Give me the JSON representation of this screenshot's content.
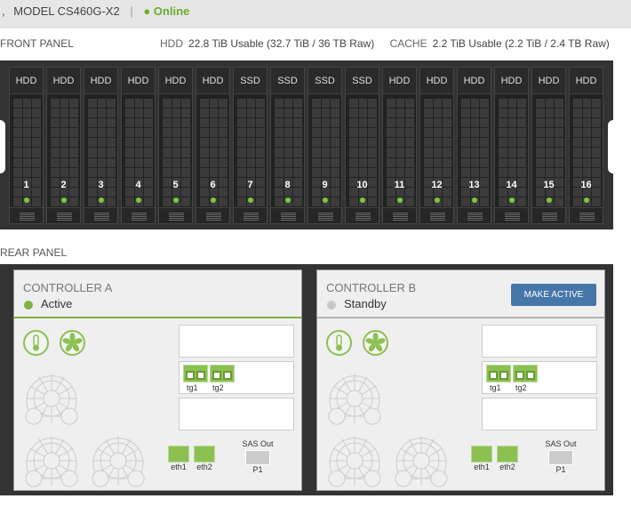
{
  "header": {
    "prefix": ",",
    "model": "MODEL CS460G-X2",
    "separator": "|",
    "status": "● Online"
  },
  "front": {
    "label": "FRONT PANEL",
    "hdd_key": "HDD",
    "hdd_value": "22.8 TiB Usable (32.7 TiB / 36 TB Raw)",
    "cache_key": "CACHE",
    "cache_value": "2.2 TiB Usable (2.2 TiB / 2.4 TB Raw)",
    "drives": [
      {
        "type": "HDD",
        "num": "1"
      },
      {
        "type": "HDD",
        "num": "2"
      },
      {
        "type": "HDD",
        "num": "3"
      },
      {
        "type": "HDD",
        "num": "4"
      },
      {
        "type": "HDD",
        "num": "5"
      },
      {
        "type": "HDD",
        "num": "6"
      },
      {
        "type": "SSD",
        "num": "7"
      },
      {
        "type": "SSD",
        "num": "8"
      },
      {
        "type": "SSD",
        "num": "9"
      },
      {
        "type": "SSD",
        "num": "10"
      },
      {
        "type": "HDD",
        "num": "11"
      },
      {
        "type": "HDD",
        "num": "12"
      },
      {
        "type": "HDD",
        "num": "13"
      },
      {
        "type": "HDD",
        "num": "14"
      },
      {
        "type": "HDD",
        "num": "15"
      },
      {
        "type": "HDD",
        "num": "16"
      }
    ]
  },
  "rear": {
    "label": "REAR PANEL",
    "controllers": [
      {
        "title": "CONTROLLER A",
        "state": "Active",
        "color": "#7cb342",
        "ports": {
          "tg1": "tg1",
          "tg2": "tg2",
          "eth1": "eth1",
          "eth2": "eth2",
          "sas_label": "SAS Out",
          "p1": "P1"
        }
      },
      {
        "title": "CONTROLLER B",
        "state": "Standby",
        "color": "#c8c8c8",
        "button": "MAKE ACTIVE",
        "ports": {
          "tg1": "tg1",
          "tg2": "tg2",
          "eth1": "eth1",
          "eth2": "eth2",
          "sas_label": "SAS Out",
          "p1": "P1"
        }
      }
    ]
  }
}
